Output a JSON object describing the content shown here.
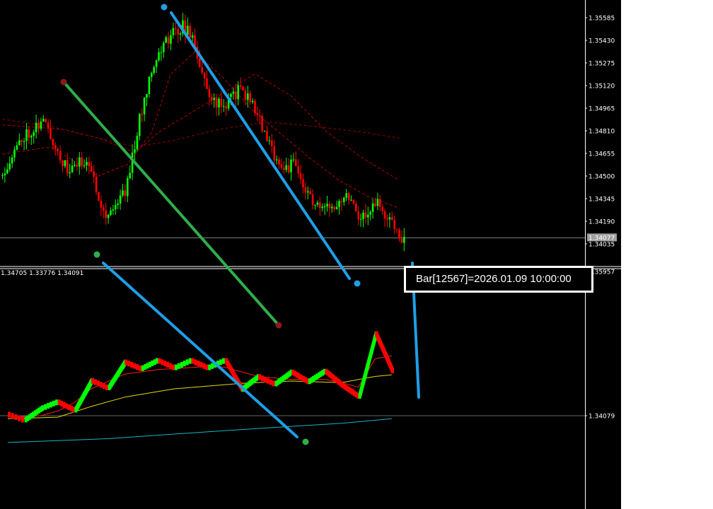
{
  "chart_data": [
    {
      "type": "candlestick",
      "panel": "main-price-chart",
      "title": "",
      "xlabel": "",
      "ylabel": "",
      "ylim": [
        1.3392,
        1.3565
      ],
      "y_ticks": [
        "1.35585",
        "1.35430",
        "1.35275",
        "1.35120",
        "1.34965",
        "1.34810",
        "1.34655",
        "1.34500",
        "1.34345",
        "1.34190",
        "1.34035"
      ],
      "current_price_label": "1.34077",
      "current_price": 1.34077,
      "grid": false,
      "series": [
        {
          "kind": "candles",
          "count": 130,
          "shape": [
            [
              0,
              1.345
            ],
            [
              10,
              1.3478
            ],
            [
              18,
              1.3488
            ],
            [
              28,
              1.3453
            ],
            [
              36,
              1.3462
            ],
            [
              44,
              1.3422
            ],
            [
              52,
              1.344
            ],
            [
              58,
              1.3488
            ],
            [
              63,
              1.3525
            ],
            [
              70,
              1.3545
            ],
            [
              76,
              1.3553
            ],
            [
              80,
              1.3545
            ],
            [
              86,
              1.3508
            ],
            [
              92,
              1.3497
            ],
            [
              100,
              1.351
            ],
            [
              106,
              1.3497
            ],
            [
              112,
              1.347
            ],
            [
              118,
              1.3455
            ],
            [
              122,
              1.3458
            ],
            [
              128,
              1.3437
            ],
            [
              134,
              1.3425
            ],
            [
              140,
              1.3433
            ],
            [
              145,
              1.3438
            ],
            [
              150,
              1.3421
            ],
            [
              157,
              1.3432
            ],
            [
              160,
              1.342
            ],
            [
              164,
              1.3418
            ],
            [
              167,
              1.3404
            ]
          ]
        },
        {
          "kind": "moving-average",
          "color": "#b40000",
          "points": [
            [
              0,
              1.3465
            ],
            [
              20,
              1.347
            ],
            [
              40,
              1.345
            ],
            [
              52,
              1.3458
            ],
            [
              62,
              1.348
            ],
            [
              70,
              1.352
            ],
            [
              80,
              1.3535
            ],
            [
              92,
              1.3517
            ],
            [
              104,
              1.3495
            ],
            [
              115,
              1.348
            ],
            [
              128,
              1.3462
            ],
            [
              140,
              1.3447
            ],
            [
              152,
              1.3436
            ],
            [
              165,
              1.3428
            ]
          ]
        },
        {
          "kind": "moving-average",
          "color": "#b40000",
          "points": [
            [
              0,
              1.3485
            ],
            [
              25,
              1.3482
            ],
            [
              40,
              1.3476
            ],
            [
              55,
              1.3466
            ],
            [
              65,
              1.348
            ],
            [
              90,
              1.3505
            ],
            [
              105,
              1.352
            ],
            [
              120,
              1.3505
            ],
            [
              135,
              1.348
            ],
            [
              150,
              1.3462
            ],
            [
              165,
              1.3447
            ]
          ]
        },
        {
          "kind": "moving-average",
          "color": "#8c0000",
          "points": [
            [
              0,
              1.3489
            ],
            [
              20,
              1.3484
            ],
            [
              40,
              1.3476
            ],
            [
              55,
              1.347
            ],
            [
              70,
              1.3474
            ],
            [
              90,
              1.3482
            ],
            [
              110,
              1.3487
            ],
            [
              130,
              1.3484
            ],
            [
              150,
              1.348
            ],
            [
              165,
              1.3476
            ]
          ]
        }
      ]
    },
    {
      "type": "renko",
      "panel": "sub-window-renko",
      "title": "",
      "xlabel": "",
      "ylabel": "",
      "header_values": "1.34705 1.33776 1.34091",
      "y_ticks": [
        "1.35957",
        "1.34079"
      ],
      "current_price": 1.34079,
      "grid": false,
      "brick_points": [
        [
          0,
          1.341
        ],
        [
          1,
          1.3402
        ],
        [
          2,
          1.3417
        ],
        [
          3,
          1.3426
        ],
        [
          4,
          1.3415
        ],
        [
          5,
          1.3454
        ],
        [
          6,
          1.3444
        ],
        [
          7,
          1.3478
        ],
        [
          8,
          1.3469
        ],
        [
          9,
          1.348
        ],
        [
          10,
          1.347
        ],
        [
          11,
          1.348
        ],
        [
          12,
          1.347
        ],
        [
          13,
          1.348
        ],
        [
          14,
          1.3442
        ],
        [
          15,
          1.3459
        ],
        [
          16,
          1.3449
        ],
        [
          17,
          1.3465
        ],
        [
          18,
          1.3452
        ],
        [
          19,
          1.3466
        ],
        [
          20,
          1.3448
        ],
        [
          21,
          1.3433
        ],
        [
          22,
          1.3515
        ],
        [
          23,
          1.3466
        ]
      ],
      "series": [
        {
          "kind": "moving-average",
          "color": "#ff1a1a",
          "points": [
            [
              0,
              1.3406
            ],
            [
              2,
              1.3408
            ],
            [
              3,
              1.3414
            ],
            [
              4,
              1.3425
            ],
            [
              5,
              1.3443
            ],
            [
              7,
              1.3462
            ],
            [
              9,
              1.3468
            ],
            [
              12,
              1.3472
            ],
            [
              13,
              1.3471
            ],
            [
              15,
              1.3459
            ],
            [
              17,
              1.3455
            ],
            [
              19,
              1.3455
            ],
            [
              20,
              1.3451
            ],
            [
              21,
              1.3445
            ],
            [
              22,
              1.3482
            ],
            [
              23,
              1.3486
            ]
          ]
        },
        {
          "kind": "moving-average",
          "color": "#e8d800",
          "points": [
            [
              0,
              1.3404
            ],
            [
              3,
              1.3406
            ],
            [
              5,
              1.342
            ],
            [
              7,
              1.3432
            ],
            [
              10,
              1.3443
            ],
            [
              14,
              1.345
            ],
            [
              17,
              1.3453
            ],
            [
              20,
              1.3451
            ],
            [
              22,
              1.3459
            ],
            [
              23,
              1.3461
            ]
          ]
        },
        {
          "kind": "moving-average",
          "color": "#19b5c6",
          "points": [
            [
              0,
              1.3373
            ],
            [
              6,
              1.3378
            ],
            [
              12,
              1.3387
            ],
            [
              17,
              1.3394
            ],
            [
              20,
              1.3398
            ],
            [
              23,
              1.3404
            ]
          ]
        }
      ]
    }
  ],
  "trendlines": {
    "green_color": "#2fae4a",
    "blue_color": "#1e9fe6",
    "anchor_red_color": "#8b1a1a",
    "anchor_green_color": "#2fae4a"
  },
  "tooltip": {
    "text": "Bar[12567]=2026.01.09 10:00:00"
  },
  "colors": {
    "background": "#000000",
    "bull": "#00ff00",
    "bear": "#ff0000",
    "axis": "#ffffff",
    "price_line": "#c8c8c8",
    "price_label_bg": "#a0a0a0"
  }
}
